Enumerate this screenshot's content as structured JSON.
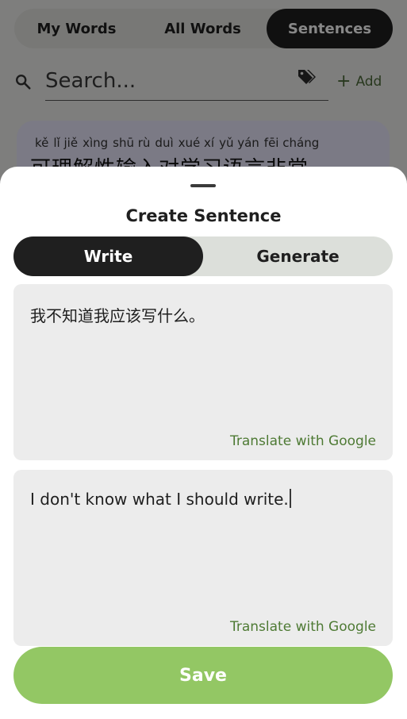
{
  "nav": {
    "tabs": [
      "My Words",
      "All Words",
      "Sentences"
    ],
    "active_tab": "Sentences"
  },
  "search": {
    "placeholder": "Search...",
    "add_label": "Add",
    "add_icon": "plus-icon",
    "filter_icon": "tags-icon"
  },
  "card": {
    "pinyin": [
      "kě",
      "lǐ jiě",
      "xìng",
      "shū rù",
      "duì",
      "xué xí",
      "yǔ yán",
      "fēi cháng"
    ],
    "hanzi": "可理解性输入对学习语言非常"
  },
  "sheet": {
    "title": "Create Sentence",
    "modes": [
      "Write",
      "Generate"
    ],
    "active_mode": "Write",
    "original_text": "我不知道我应该写什么。",
    "translation_text": "I don't know what I should write.",
    "translate_label": "Translate with Google",
    "save_label": "Save"
  },
  "colors": {
    "accent_green": "#93c764",
    "link_green": "#4e7a34",
    "dark": "#1f1f1f",
    "card_lavender": "#e9e6fb"
  }
}
